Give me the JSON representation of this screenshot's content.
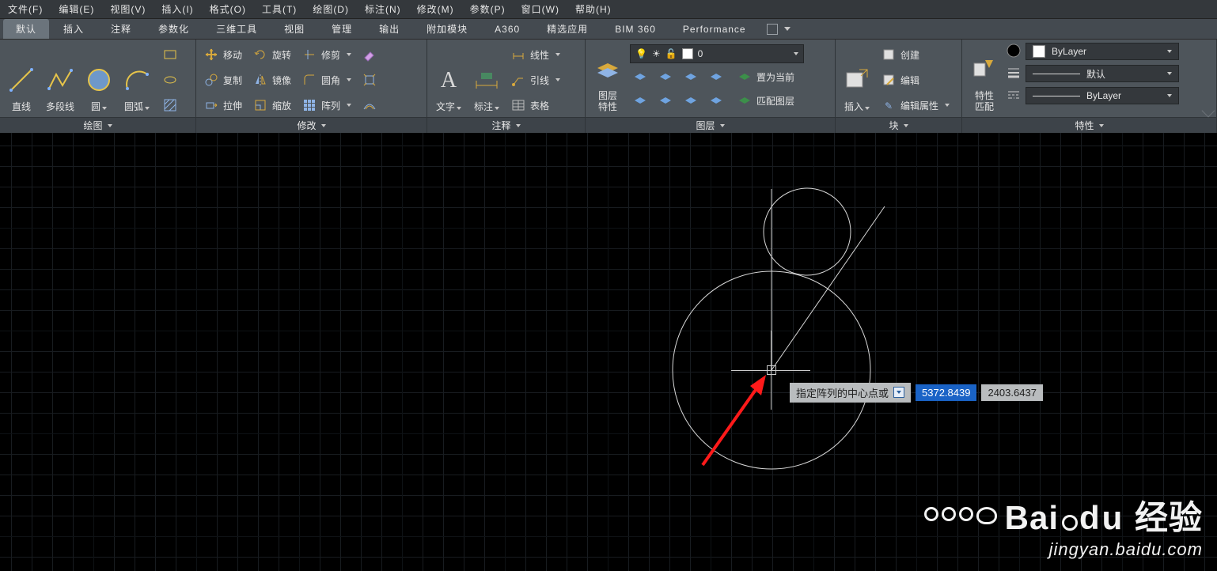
{
  "menu": {
    "items": [
      "文件(F)",
      "编辑(E)",
      "视图(V)",
      "插入(I)",
      "格式(O)",
      "工具(T)",
      "绘图(D)",
      "标注(N)",
      "修改(M)",
      "参数(P)",
      "窗口(W)",
      "帮助(H)"
    ]
  },
  "tabs": {
    "items": [
      "默认",
      "插入",
      "注释",
      "参数化",
      "三维工具",
      "视图",
      "管理",
      "输出",
      "附加模块",
      "A360",
      "精选应用",
      "BIM 360",
      "Performance"
    ],
    "active_index": 0
  },
  "ribbon": {
    "draw": {
      "title": "绘图",
      "line": "直线",
      "polyline": "多段线",
      "circle": "圆",
      "arc": "圆弧"
    },
    "modify": {
      "title": "修改",
      "move": "移动",
      "copy": "复制",
      "stretch": "拉伸",
      "rotate": "旋转",
      "mirror": "镜像",
      "scale": "缩放",
      "trim": "修剪",
      "fillet": "圆角",
      "array": "阵列"
    },
    "annotate": {
      "title": "注释",
      "text": "文字",
      "dim": "标注",
      "linear": "线性",
      "leader": "引线",
      "table": "表格"
    },
    "layers": {
      "title": "图层",
      "props": "图层\n特性",
      "current_layer": "0",
      "set_current": "置为当前",
      "match": "匹配图层"
    },
    "block": {
      "title": "块",
      "insert": "插入",
      "create": "创建",
      "edit": "编辑",
      "editattr": "编辑属性"
    },
    "properties": {
      "title": "特性",
      "match": "特性\n匹配",
      "bylayer": "ByLayer",
      "default_lt": "默认",
      "bylayer_lw": "ByLayer"
    }
  },
  "dynamic_input": {
    "prompt": "指定阵列的中心点或",
    "x": "5372.8439",
    "y": "2403.6437"
  },
  "watermark": {
    "line1a": "Bai",
    "line1b": "经验",
    "line2": "jingyan.baidu.com"
  }
}
